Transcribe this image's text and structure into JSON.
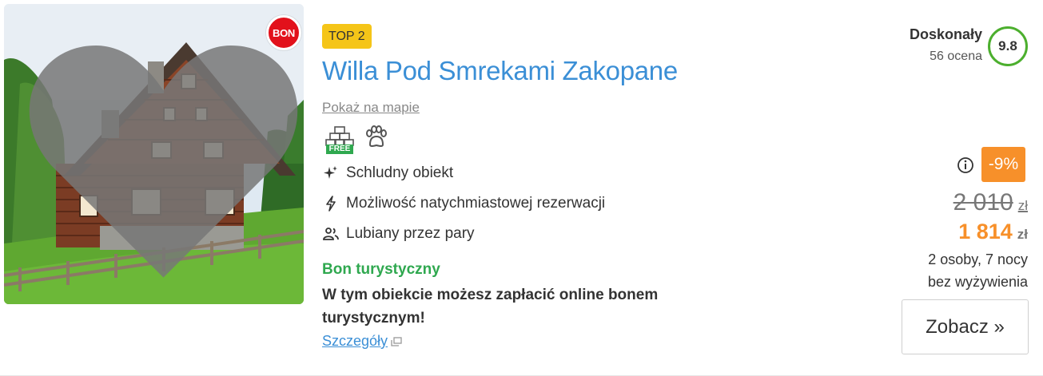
{
  "listing": {
    "bon_badge": "BON",
    "rank_badge": "TOP 2",
    "title": "Willa Pod Smrekami Zakopane",
    "map_link": "Pokaż na mapie",
    "amenities": [
      {
        "icon": "parking-icon",
        "tag": "FREE"
      },
      {
        "icon": "paw-icon"
      }
    ],
    "features": [
      {
        "icon": "sparkle-icon",
        "label": "Schludny obiekt"
      },
      {
        "icon": "lightning-icon",
        "label": "Możliwość natychmiastowej rezerwacji"
      },
      {
        "icon": "couple-icon",
        "label": "Lubiany przez pary"
      }
    ],
    "bon": {
      "title": "Bon turystyczny",
      "description": "W tym obiekcie możesz zapłacić online bonem turystycznym!",
      "details_link": "Szczegóły"
    }
  },
  "rating": {
    "label": "Doskonały",
    "count": "56 ocena",
    "score": "9.8"
  },
  "price": {
    "discount": "-9%",
    "old": "2 010",
    "new": "1 814",
    "currency": "zł",
    "stay": "2 osoby, 7 nocy",
    "board": "bez wyżywienia",
    "button": "Zobacz »"
  },
  "colors": {
    "title": "#3b8fd6",
    "rank_badge": "#f5c518",
    "bon_green": "#2fa84f",
    "discount": "#f7902a",
    "rating_ring": "#4caf2e",
    "bon_badge": "#e2111b"
  }
}
